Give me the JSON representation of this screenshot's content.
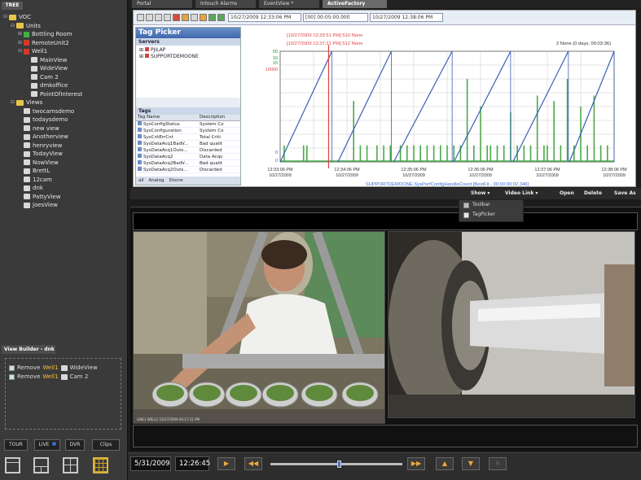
{
  "left_panel": {
    "tree_tab": "TREE",
    "tree": [
      {
        "label": "VOC",
        "kind": "folder",
        "indent": 0,
        "expand": "⊟"
      },
      {
        "label": "Units",
        "kind": "folder",
        "indent": 1,
        "expand": "⊟"
      },
      {
        "label": "Bottling Room",
        "kind": "unit-green",
        "indent": 2,
        "expand": "⊞"
      },
      {
        "label": "RemoteUnit2",
        "kind": "unit-red",
        "indent": 2,
        "expand": "⊞"
      },
      {
        "label": "Well1",
        "kind": "unit-red",
        "indent": 2,
        "expand": "⊟"
      },
      {
        "label": "MainView",
        "kind": "view",
        "indent": 3,
        "expand": ""
      },
      {
        "label": "WideView",
        "kind": "view",
        "indent": 3,
        "expand": ""
      },
      {
        "label": "Cam 2",
        "kind": "view",
        "indent": 3,
        "expand": ""
      },
      {
        "label": "dmkoffice",
        "kind": "view",
        "indent": 3,
        "expand": ""
      },
      {
        "label": "PointOfInterest",
        "kind": "view",
        "indent": 3,
        "expand": ""
      },
      {
        "label": "Views",
        "kind": "folder",
        "indent": 1,
        "expand": "⊟"
      },
      {
        "label": "twocamsdemo",
        "kind": "view",
        "indent": 2,
        "expand": ""
      },
      {
        "label": "todaysdemo",
        "kind": "view",
        "indent": 2,
        "expand": ""
      },
      {
        "label": "new view",
        "kind": "view",
        "indent": 2,
        "expand": ""
      },
      {
        "label": "Anotherview",
        "kind": "view",
        "indent": 2,
        "expand": ""
      },
      {
        "label": "henryview",
        "kind": "view",
        "indent": 2,
        "expand": ""
      },
      {
        "label": "TodayView",
        "kind": "view",
        "indent": 2,
        "expand": ""
      },
      {
        "label": "NowView",
        "kind": "view",
        "indent": 2,
        "expand": ""
      },
      {
        "label": "BrettL",
        "kind": "view",
        "indent": 2,
        "expand": ""
      },
      {
        "label": "12cam",
        "kind": "view",
        "indent": 2,
        "expand": ""
      },
      {
        "label": "dnk",
        "kind": "view",
        "indent": 2,
        "expand": ""
      },
      {
        "label": "PattyView",
        "kind": "view",
        "indent": 2,
        "expand": ""
      },
      {
        "label": "JoesView",
        "kind": "view",
        "indent": 2,
        "expand": ""
      }
    ],
    "view_builder_tab": "View Builder - dnk",
    "view_builder_rows": [
      {
        "action": "Remove",
        "unit": "Well1",
        "view": "WideView"
      },
      {
        "action": "Remove",
        "unit": "Well1",
        "view": "Cam 2"
      }
    ],
    "buttons": {
      "tour": "TOUR",
      "live": "LIVE",
      "dvr": "DVR",
      "clips": "Clips"
    }
  },
  "tabs": [
    "Portal",
    "Intouch Alarms",
    "EventView *",
    "ActiveFactory"
  ],
  "active_tab": 3,
  "toolbar": {
    "start_time": "10/27/2009 12:33:06 PM",
    "duration": "[00] 00:05:00.000",
    "end_time": "10/27/2009 12:38:06 PM"
  },
  "tag_picker": {
    "title": "Tag Picker",
    "servers_header": "Servers",
    "servers": [
      "PJILAP",
      "SUPPORTDEMOONE"
    ],
    "tags_header": "Tags",
    "columns": [
      "Tag Name",
      "Description"
    ],
    "rows": [
      [
        "SysConfigStatus",
        "System Co"
      ],
      [
        "SysConfiguration",
        "System Co"
      ],
      [
        "SysCritErrCnt",
        "Total Criti"
      ],
      [
        "SysDataAcq1BadV...",
        "Bad qualit"
      ],
      [
        "SysDataAcq1Outs...",
        "Discarded"
      ],
      [
        "SysDataAcq2",
        "Data Acqu"
      ],
      [
        "SysDataAcq2BadV...",
        "Bad qualit"
      ],
      [
        "SysDataAcq2Outs...",
        "Discarded"
      ]
    ],
    "footer": [
      "all",
      "Analog",
      "Discre"
    ]
  },
  "chart_data": {
    "type": "line",
    "annotations_red": [
      "[10/27/2009 12:33:51 PM] 510 None",
      "[10/27/2009 12:37:21 PM] 512 None"
    ],
    "annotation_right": "2 None (0 days, 00:03:36)",
    "y_tick_labels": [
      "50",
      "10",
      "15",
      "10000",
      "0",
      "0"
    ],
    "x_ticks": [
      "12:33:06 PM\n10/27/2009",
      "12:34:06 PM\n10/27/2009",
      "12:35:06 PM\n10/27/2009",
      "12:36:06 PM\n10/27/2009",
      "12:37:06 PM\n10/27/2009",
      "12:38:06 PM\n10/27/2009"
    ],
    "caption": "SUPPORTDEMOONE.SysPerfConfigHandleCount [BestFit - 00:00:00:02.346]",
    "series": [
      {
        "color": "#3a5fb5",
        "kind": "sawtooth",
        "ramps": [
          [
            0.0,
            0.155
          ],
          [
            0.173,
            0.333
          ],
          [
            0.34,
            0.515
          ],
          [
            0.52,
            0.69
          ],
          [
            0.697,
            0.863
          ],
          [
            0.866,
            1.0
          ]
        ]
      },
      {
        "color": "#4aa84a",
        "kind": "bars"
      }
    ],
    "colors": {
      "grid": "#c9c9c9",
      "axis": "#555555",
      "red_marker": "#e04040"
    }
  },
  "af_bar": {
    "show": "Show",
    "video_link": "Video Link",
    "open": "Open",
    "delete": "Delete",
    "save_as": "Save As"
  },
  "dropdown": {
    "items": [
      {
        "label": "Toolbar",
        "checked": false
      },
      {
        "label": "TagPicker",
        "checked": true
      }
    ]
  },
  "camera1_caption": "LINE1-WELL1 10/27/2009 04:17:21 PM",
  "playback": {
    "date": "5/31/2009",
    "time": "12:26:45",
    "slider_position": 0.52
  }
}
